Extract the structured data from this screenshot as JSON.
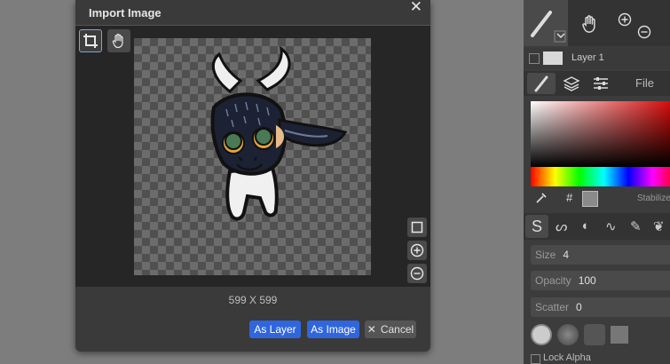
{
  "dialog": {
    "title": "Import Image",
    "close_icon": "close-icon",
    "dimensions": "599 X 599",
    "buttons": {
      "as_layer": "As Layer",
      "as_image": "As Image",
      "cancel": "Cancel"
    },
    "tools": [
      "crop-icon",
      "hand-icon"
    ],
    "side_tools": [
      "square-icon",
      "zoom-in-icon",
      "zoom-out-icon"
    ]
  },
  "panel": {
    "layer_name": "Layer 1",
    "tab_file": "File",
    "hex_label": "#",
    "stabilizer": "Stabilizer",
    "size_label": "Size",
    "size_value": "4",
    "opacity_label": "Opacity",
    "opacity_value": "100",
    "scatter_label": "Scatter",
    "scatter_value": "0",
    "lock_alpha": "Lock Alpha"
  },
  "colors": {
    "accent": "#2f66de",
    "dialog_bg": "#3a3a3a",
    "canvas_bg": "#262626"
  }
}
